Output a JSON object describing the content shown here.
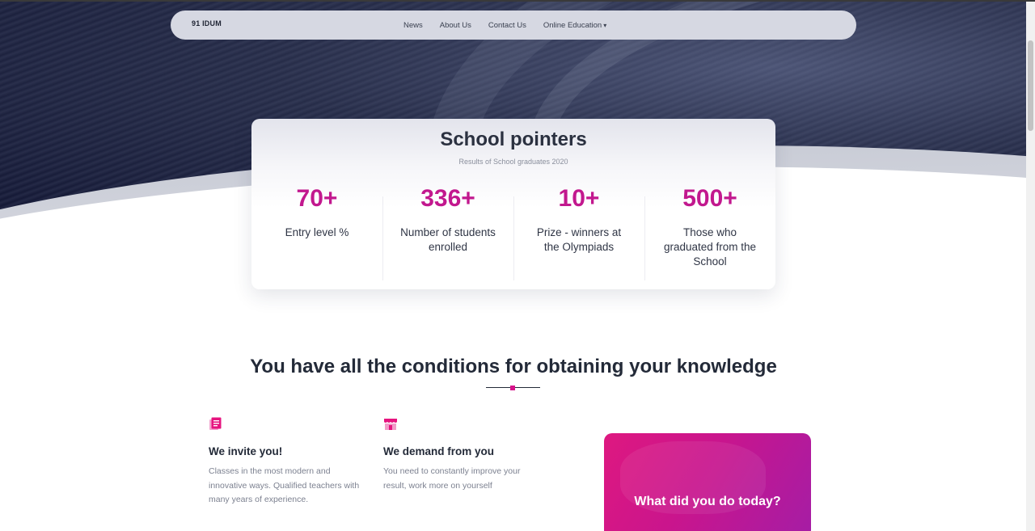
{
  "nav": {
    "logo": "91 IDUM",
    "links": [
      "News",
      "About Us",
      "Contact Us",
      "Online Education"
    ]
  },
  "pointers": {
    "title": "School pointers",
    "subtitle": "Results of School graduates 2020",
    "stats": [
      {
        "value": "70+",
        "label": "Entry level %"
      },
      {
        "value": "336+",
        "label": "Number of students enrolled"
      },
      {
        "value": "10+",
        "label": "Prize - winners at the Olympiads"
      },
      {
        "value": "500+",
        "label": "Those who graduated from the School"
      }
    ]
  },
  "conditions": {
    "title": "You have all the conditions for obtaining your knowledge",
    "features": [
      {
        "icon": "document-icon",
        "title": "We invite you!",
        "text": "Classes in the most modern and innovative ways. Qualified teachers with many years of experience."
      },
      {
        "icon": "store-icon",
        "title": "We demand from you",
        "text": "You need to constantly improve your result, work more on yourself"
      }
    ],
    "promo": "What did you do today?"
  },
  "colors": {
    "accent": "#c2188e",
    "hero_dark": "#121633",
    "nav_bg": "#d6d8e2",
    "promo_start": "#de1880",
    "promo_end": "#a51da5"
  }
}
